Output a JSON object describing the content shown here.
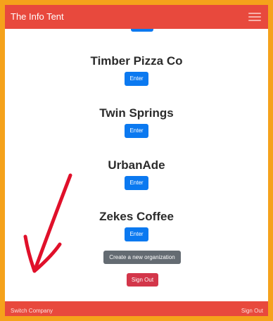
{
  "header": {
    "brand": "The Info Tent",
    "menu_icon": "hamburger-menu-icon",
    "background": "#e8493d"
  },
  "organizations": [
    {
      "name": "Timber Pizza Co",
      "button_label": "Enter"
    },
    {
      "name": "Twin Springs",
      "button_label": "Enter"
    },
    {
      "name": "UrbanAde",
      "button_label": "Enter"
    },
    {
      "name": "Zekes Coffee",
      "button_label": "Enter"
    }
  ],
  "actions": {
    "create_label": "Create a new organization",
    "signout_label": "Sign Out"
  },
  "footer": {
    "switch_company": "Switch Company",
    "sign_out": "Sign Out"
  },
  "colors": {
    "frame_border": "#f5a21b",
    "primary_button": "#0b79f0",
    "secondary_button": "#646b72",
    "danger_button": "#d3364a",
    "annotation_arrow": "#e0102a"
  }
}
